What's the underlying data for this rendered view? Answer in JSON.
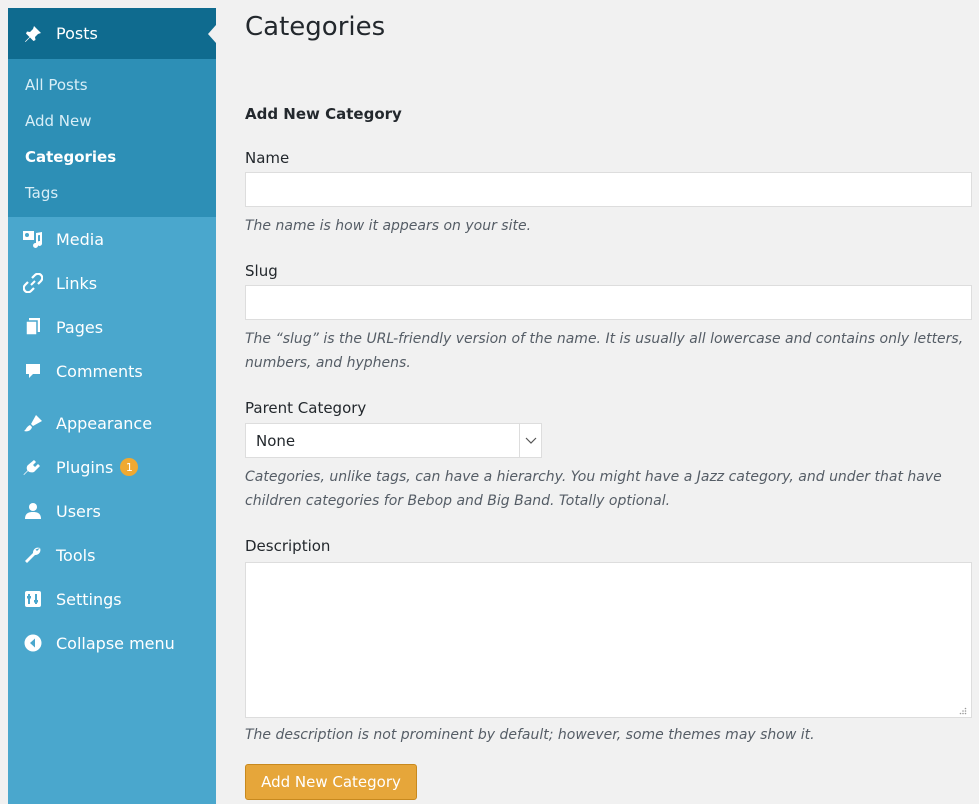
{
  "sidebar": {
    "current": {
      "label": "Posts",
      "icon": "pin-icon"
    },
    "submenu": [
      {
        "label": "All Posts",
        "current": false
      },
      {
        "label": "Add New",
        "current": false
      },
      {
        "label": "Categories",
        "current": true
      },
      {
        "label": "Tags",
        "current": false
      }
    ],
    "items": [
      {
        "label": "Media",
        "icon": "media-icon"
      },
      {
        "label": "Links",
        "icon": "link-icon"
      },
      {
        "label": "Pages",
        "icon": "pages-icon"
      },
      {
        "label": "Comments",
        "icon": "comment-icon"
      },
      {
        "label": "Appearance",
        "icon": "brush-icon"
      },
      {
        "label": "Plugins",
        "icon": "plugin-icon",
        "badge": "1"
      },
      {
        "label": "Users",
        "icon": "user-icon"
      },
      {
        "label": "Tools",
        "icon": "wrench-icon"
      },
      {
        "label": "Settings",
        "icon": "settings-icon"
      },
      {
        "label": "Collapse menu",
        "icon": "collapse-icon"
      }
    ]
  },
  "main": {
    "title": "Categories",
    "form_title": "Add New Category",
    "name": {
      "label": "Name",
      "value": "",
      "help": "The name is how it appears on your site."
    },
    "slug": {
      "label": "Slug",
      "value": "",
      "help": "The “slug” is the URL-friendly version of the name. It is usually all lowercase and contains only letters, numbers, and hyphens."
    },
    "parent": {
      "label": "Parent Category",
      "selected": "None",
      "help": "Categories, unlike tags, can have a hierarchy. You might have a Jazz category, and under that have children categories for Bebop and Big Band. Totally optional."
    },
    "description": {
      "label": "Description",
      "value": "",
      "help": "The description is not prominent by default; however, some themes may show it."
    },
    "submit_label": "Add New Category"
  },
  "colors": {
    "sidebar_bg": "#4aa7cd",
    "sidebar_current": "#0f6b8f",
    "submenu_bg": "#2d8fb6",
    "badge": "#f0a931",
    "button": "#e6a63a"
  }
}
